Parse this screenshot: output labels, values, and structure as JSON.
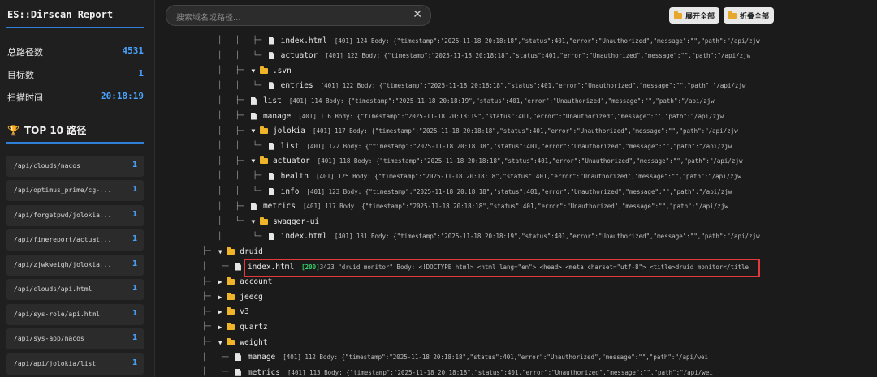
{
  "sidebar": {
    "title": "ES::Dirscan Report",
    "stats": [
      {
        "label": "总路径数",
        "value": "4531"
      },
      {
        "label": "目标数",
        "value": "1"
      },
      {
        "label": "扫描时间",
        "value": "20:18:19"
      }
    ],
    "top_title": "TOP 10 路径",
    "top_items": [
      {
        "path": "/api/clouds/nacos",
        "count": "1"
      },
      {
        "path": "/api/optimus_prime/cg-...",
        "count": "1"
      },
      {
        "path": "/api/forgetpwd/jolokia...",
        "count": "1"
      },
      {
        "path": "/api/finereport/actuat...",
        "count": "1"
      },
      {
        "path": "/api/zjwkweigh/jolokia...",
        "count": "1"
      },
      {
        "path": "/api/clouds/api.html",
        "count": "1"
      },
      {
        "path": "/api/sys-role/api.html",
        "count": "1"
      },
      {
        "path": "/api/sys-app/nacos",
        "count": "1"
      },
      {
        "path": "/api/api/jolokia/list",
        "count": "1"
      }
    ]
  },
  "topbar": {
    "search_placeholder": "搜索域名或路径...",
    "clear_icon": "✕",
    "expand_all": "展开全部",
    "collapse_all": "折叠全部"
  },
  "tree": {
    "rows": [
      {
        "guides": "│   │   ├─ ",
        "type": "file",
        "name": "index.html",
        "status": "401",
        "meta": "[401] 124 Body: {\"timestamp\":\"2025-11-18 20:18:18\",\"status\":401,\"error\":\"Unauthorized\",\"message\":\"\",\"path\":\"/api/zjw"
      },
      {
        "guides": "│   │   └─ ",
        "type": "file",
        "name": "actuator",
        "status": "401",
        "meta": "[401] 122 Body: {\"timestamp\":\"2025-11-18 20:18:18\",\"status\":401,\"error\":\"Unauthorized\",\"message\":\"\",\"path\":\"/api/zjw"
      },
      {
        "guides": "│   ├─ ",
        "type": "dir-open",
        "name": ".svn",
        "meta": ""
      },
      {
        "guides": "│   │   └─ ",
        "type": "file",
        "name": "entries",
        "status": "401",
        "meta": "[401] 122 Body: {\"timestamp\":\"2025-11-18 20:18:18\",\"status\":401,\"error\":\"Unauthorized\",\"message\":\"\",\"path\":\"/api/zjw"
      },
      {
        "guides": "│   ├─ ",
        "type": "file",
        "name": "list",
        "status": "401",
        "meta": "[401] 114 Body: {\"timestamp\":\"2025-11-18 20:18:19\",\"status\":401,\"error\":\"Unauthorized\",\"message\":\"\",\"path\":\"/api/zjw"
      },
      {
        "guides": "│   ├─ ",
        "type": "file",
        "name": "manage",
        "status": "401",
        "meta": "[401] 116 Body: {\"timestamp\":\"2025-11-18 20:18:19\",\"status\":401,\"error\":\"Unauthorized\",\"message\":\"\",\"path\":\"/api/zjw"
      },
      {
        "guides": "│   ├─ ",
        "type": "dir-open",
        "name": "jolokia",
        "meta": "[401] 117 Body: {\"timestamp\":\"2025-11-18 20:18:18\",\"status\":401,\"error\":\"Unauthorized\",\"message\":\"\",\"path\":\"/api/zjw"
      },
      {
        "guides": "│   │   └─ ",
        "type": "file",
        "name": "list",
        "status": "401",
        "meta": "[401] 122 Body: {\"timestamp\":\"2025-11-18 20:18:18\",\"status\":401,\"error\":\"Unauthorized\",\"message\":\"\",\"path\":\"/api/zjw"
      },
      {
        "guides": "│   ├─ ",
        "type": "dir-open",
        "name": "actuator",
        "meta": "[401] 118 Body: {\"timestamp\":\"2025-11-18 20:18:18\",\"status\":401,\"error\":\"Unauthorized\",\"message\":\"\",\"path\":\"/api/zjw"
      },
      {
        "guides": "│   │   ├─ ",
        "type": "file",
        "name": "health",
        "status": "401",
        "meta": "[401] 125 Body: {\"timestamp\":\"2025-11-18 20:18:18\",\"status\":401,\"error\":\"Unauthorized\",\"message\":\"\",\"path\":\"/api/zjw"
      },
      {
        "guides": "│   │   └─ ",
        "type": "file",
        "name": "info",
        "status": "401",
        "meta": "[401] 123 Body: {\"timestamp\":\"2025-11-18 20:18:18\",\"status\":401,\"error\":\"Unauthorized\",\"message\":\"\",\"path\":\"/api/zjw"
      },
      {
        "guides": "│   ├─ ",
        "type": "file",
        "name": "metrics",
        "status": "401",
        "meta": "[401] 117 Body: {\"timestamp\":\"2025-11-18 20:18:18\",\"status\":401,\"error\":\"Unauthorized\",\"message\":\"\",\"path\":\"/api/zjw"
      },
      {
        "guides": "│   └─ ",
        "type": "dir-open",
        "name": "swagger-ui",
        "meta": ""
      },
      {
        "guides": "│       └─ ",
        "type": "file",
        "name": "index.html",
        "status": "401",
        "meta": "[401] 131 Body: {\"timestamp\":\"2025-11-18 20:18:19\",\"status\":401,\"error\":\"Unauthorized\",\"message\":\"\",\"path\":\"/api/zjw"
      },
      {
        "guides": "├─ ",
        "type": "dir-open",
        "name": "druid",
        "meta": ""
      },
      {
        "guides": "│   └─ ",
        "type": "file",
        "name": "index.html",
        "status": "200",
        "meta": "3423 \"druid monitor\" Body: <!DOCTYPE html> <html lang=\"en\"> <head> <meta charset=\"utf-8\"> <title>druid monitor</title"
      },
      {
        "guides": "├─ ",
        "type": "dir-closed",
        "name": "account",
        "meta": ""
      },
      {
        "guides": "├─ ",
        "type": "dir-closed",
        "name": "jeecg",
        "meta": ""
      },
      {
        "guides": "├─ ",
        "type": "dir-closed",
        "name": "v3",
        "meta": ""
      },
      {
        "guides": "├─ ",
        "type": "dir-closed",
        "name": "quartz",
        "meta": ""
      },
      {
        "guides": "├─ ",
        "type": "dir-open",
        "name": "weight",
        "meta": ""
      },
      {
        "guides": "│   ├─ ",
        "type": "file",
        "name": "manage",
        "status": "401",
        "meta": "[401] 112 Body: {\"timestamp\":\"2025-11-18 20:18:18\",\"status\":401,\"error\":\"Unauthorized\",\"message\":\"\",\"path\":\"/api/wei"
      },
      {
        "guides": "│   ├─ ",
        "type": "file",
        "name": "metrics",
        "status": "401",
        "meta": "[401] 113 Body: {\"timestamp\":\"2025-11-18 20:18:18\",\"status\":401,\"error\":\"Unauthorized\",\"message\":\"\",\"path\":\"/api/wei"
      }
    ]
  },
  "colors": {
    "accent": "#4aa3ff",
    "folder": "#f0b429",
    "status_ok": "#35d06a",
    "highlight": "#e03a3a"
  }
}
